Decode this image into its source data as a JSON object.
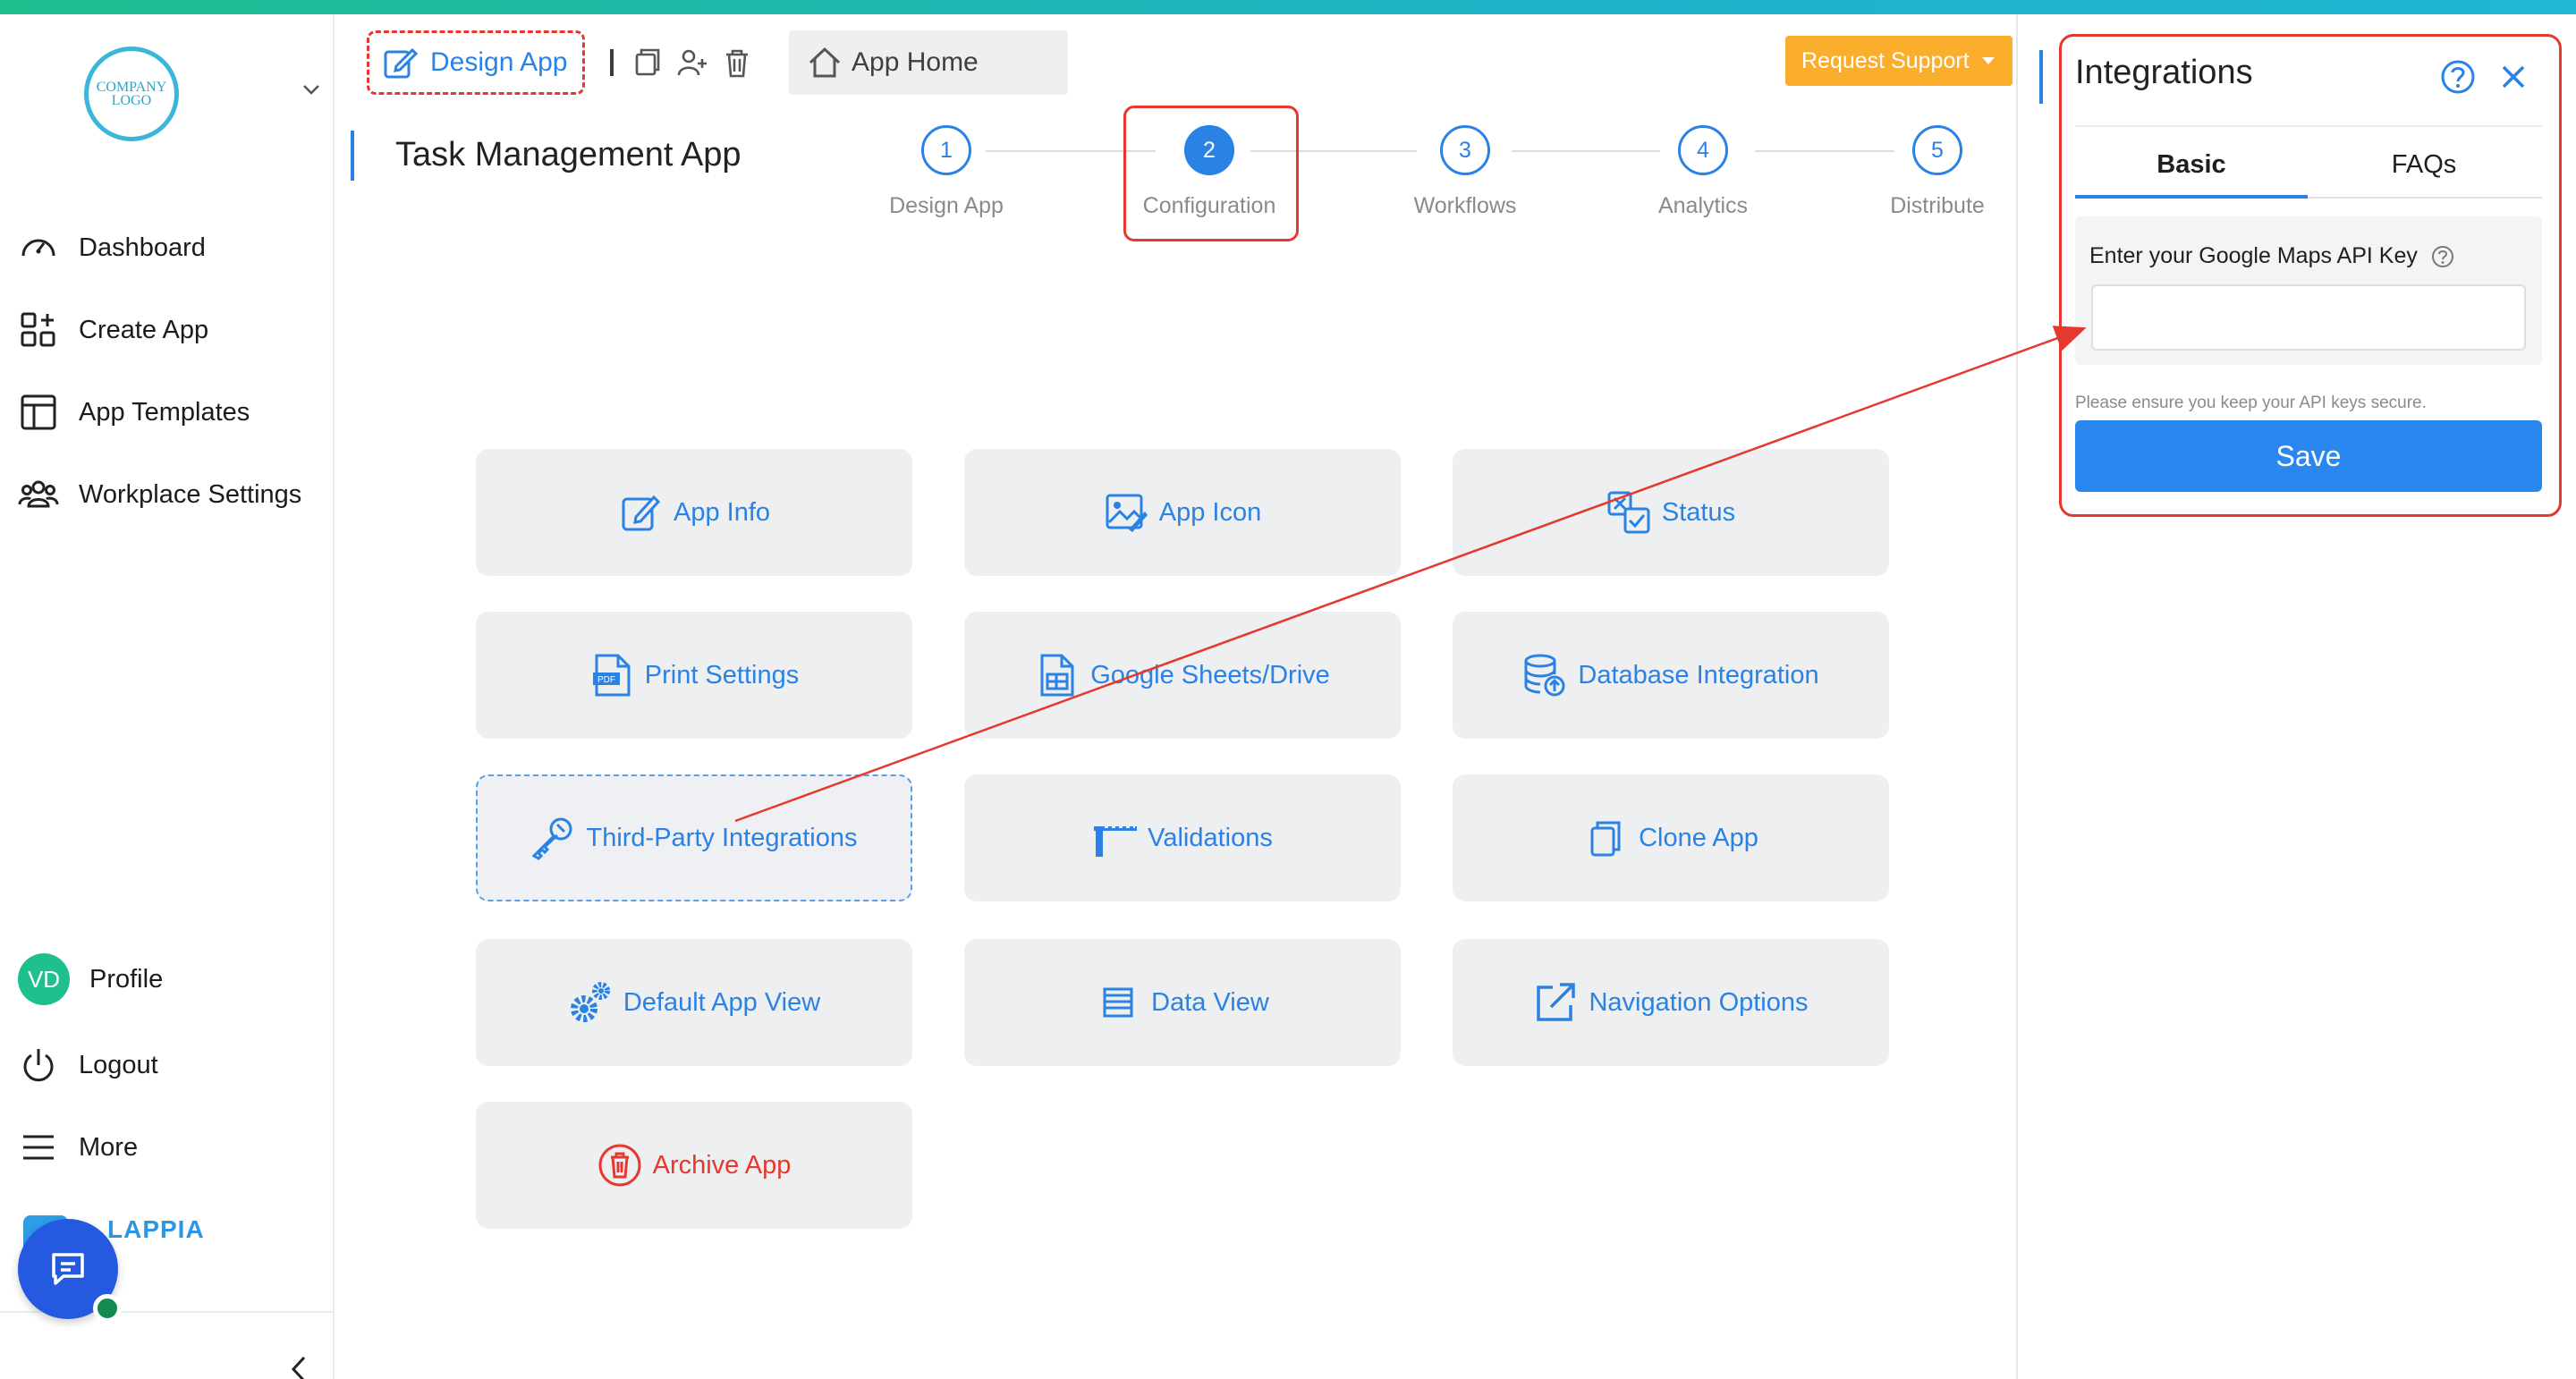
{
  "sidebar": {
    "logo_text": "COMPANY LOGO",
    "items": [
      {
        "label": "Dashboard",
        "icon": "dashboard-icon"
      },
      {
        "label": "Create App",
        "icon": "create-app-icon"
      },
      {
        "label": "App Templates",
        "icon": "templates-icon"
      },
      {
        "label": "Workplace Settings",
        "icon": "workplace-icon"
      }
    ],
    "profile": {
      "initials": "VD",
      "label": "Profile"
    },
    "logout_label": "Logout",
    "more_label": "More",
    "brand": "LAPPIA"
  },
  "header": {
    "design_app_tab": "Design App",
    "app_home_tab": "App Home",
    "request_support": "Request Support"
  },
  "main": {
    "app_title": "Task Management App",
    "steps": [
      {
        "num": "1",
        "label": "Design App"
      },
      {
        "num": "2",
        "label": "Configuration"
      },
      {
        "num": "3",
        "label": "Workflows"
      },
      {
        "num": "4",
        "label": "Analytics"
      },
      {
        "num": "5",
        "label": "Distribute"
      }
    ],
    "tiles": [
      {
        "label": "App Info",
        "icon": "edit-icon"
      },
      {
        "label": "App Icon",
        "icon": "image-icon"
      },
      {
        "label": "Status",
        "icon": "status-icon"
      },
      {
        "label": "Print Settings",
        "icon": "pdf-icon"
      },
      {
        "label": "Google Sheets/Drive",
        "icon": "sheets-icon"
      },
      {
        "label": "Database Integration",
        "icon": "database-icon"
      },
      {
        "label": "Third-Party Integrations",
        "icon": "key-icon"
      },
      {
        "label": "Validations",
        "icon": "validation-icon"
      },
      {
        "label": "Clone App",
        "icon": "copy-icon"
      },
      {
        "label": "Default App View",
        "icon": "gears-icon"
      },
      {
        "label": "Data View",
        "icon": "list-icon"
      },
      {
        "label": "Navigation Options",
        "icon": "external-link-icon"
      },
      {
        "label": "Archive App",
        "icon": "trash-icon"
      }
    ]
  },
  "panel": {
    "title": "Integrations",
    "tabs": [
      "Basic",
      "FAQs"
    ],
    "field_label": "Enter your Google Maps API Key",
    "field_value": "",
    "hint": "Please ensure you keep your API keys secure.",
    "save_label": "Save"
  },
  "colors": {
    "accent": "#2a82e4",
    "highlight": "#e5392f",
    "support": "#fbad2c",
    "tile_bg": "#eeeff1"
  }
}
